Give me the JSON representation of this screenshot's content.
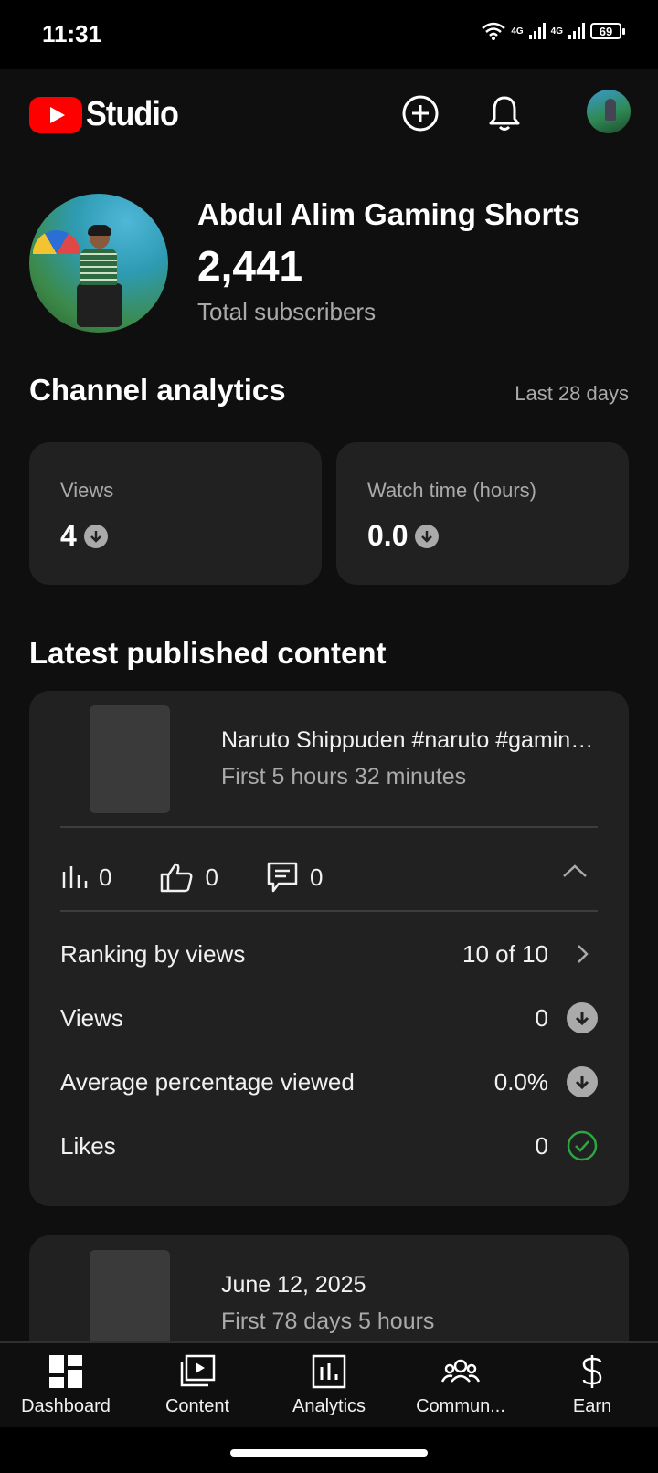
{
  "status_bar": {
    "time": "11:31",
    "net1": "4G",
    "net2": "4G",
    "battery": "69"
  },
  "app_bar": {
    "logo_text": "Studio"
  },
  "channel": {
    "name": "Abdul Alim Gaming Shorts",
    "subscribers": "2,441",
    "subscribers_label": "Total subscribers"
  },
  "analytics": {
    "title": "Channel analytics",
    "range": "Last 28 days",
    "cards": [
      {
        "label": "Views",
        "value": "4"
      },
      {
        "label": "Watch time (hours)",
        "value": "0.0"
      }
    ]
  },
  "latest": {
    "title": "Latest published content",
    "items": [
      {
        "title": "Naruto Shippuden  #naruto #gaming #shorts",
        "subtitle": "First 5 hours 32 minutes",
        "views": "0",
        "likes": "0",
        "comments": "0",
        "details": [
          {
            "label": "Ranking by views",
            "value": "10 of 10"
          },
          {
            "label": "Views",
            "value": "0"
          },
          {
            "label": "Average percentage viewed",
            "value": "0.0%"
          },
          {
            "label": "Likes",
            "value": "0"
          }
        ]
      },
      {
        "title": "June 12, 2025",
        "subtitle": "First 78 days 5 hours"
      }
    ]
  },
  "nav": [
    {
      "label": "Dashboard",
      "icon": "dashboard-icon"
    },
    {
      "label": "Content",
      "icon": "content-icon"
    },
    {
      "label": "Analytics",
      "icon": "analytics-icon"
    },
    {
      "label": "Commun...",
      "icon": "community-icon"
    },
    {
      "label": "Earn",
      "icon": "earn-icon"
    }
  ]
}
